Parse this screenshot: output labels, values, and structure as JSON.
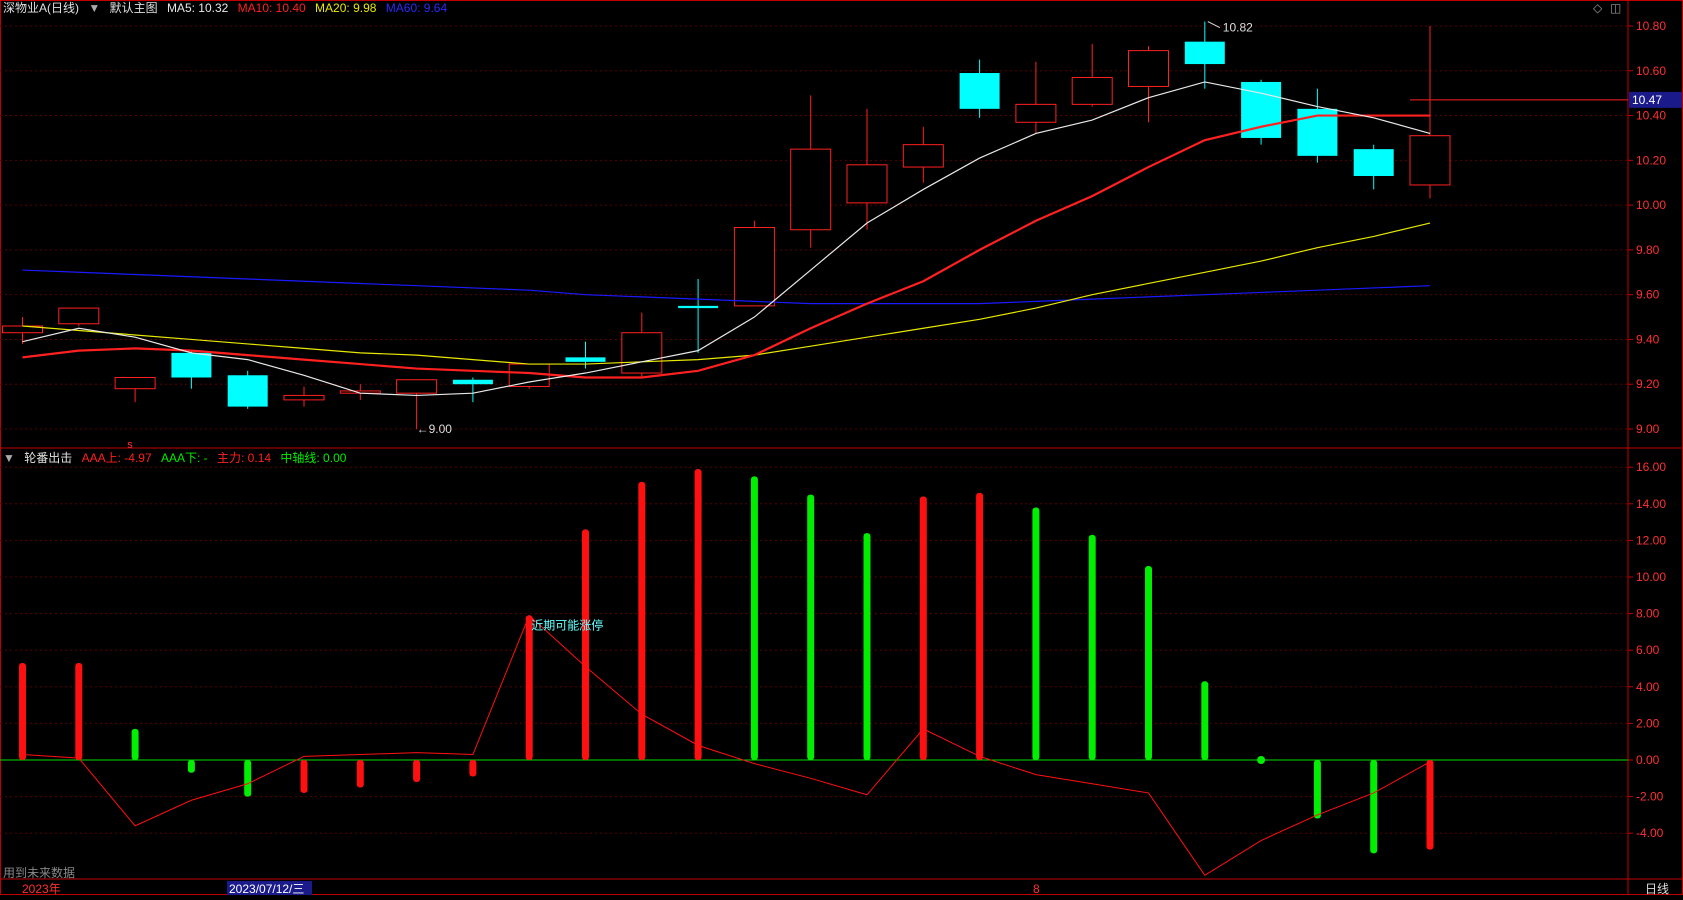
{
  "main_header": {
    "stock": "深物业A(日线)",
    "formula": "默认主图",
    "ma5": "MA5: 10.32",
    "ma10": "MA10: 10.40",
    "ma20": "MA20: 9.98",
    "ma60": "MA60: 9.64"
  },
  "sub_header": {
    "name": "轮番出击",
    "aaa_up": "AAA上: -4.97",
    "aaa_down": "AAA下: -",
    "main_force": "主力: 0.14",
    "center": "中轴线: 0.00"
  },
  "price_marker": "10.47",
  "high_label": "10.82",
  "low_label": "9.00",
  "annotation": "近期可能涨停",
  "future_note": "用到未来数据",
  "timeline": {
    "year": "2023年",
    "date": "2023/07/12/三",
    "month": "8",
    "period": "日线"
  },
  "small_marker": "s",
  "colors": {
    "up": "#ff2020",
    "down": "#00ffff",
    "ma5": "#e8e8e8",
    "ma10": "#ff2020",
    "ma20": "#e8e800",
    "ma60": "#1a1aff",
    "green": "#00ee00",
    "red": "#ff1010",
    "axis": "#c00000"
  },
  "chart_data": [
    {
      "type": "candlestick",
      "title": "深物业A(日线)",
      "ylim": [
        8.9,
        10.9
      ],
      "y_ticks": [
        "10.80",
        "10.60",
        "10.40",
        "10.20",
        "10.00",
        "9.80",
        "9.60",
        "9.40",
        "9.20",
        "9.00"
      ],
      "candles": [
        {
          "o": 9.43,
          "h": 9.5,
          "l": 9.38,
          "c": 9.46
        },
        {
          "o": 9.47,
          "h": 9.54,
          "l": 9.46,
          "c": 9.54
        },
        {
          "o": 9.18,
          "h": 9.22,
          "l": 9.12,
          "c": 9.23
        },
        {
          "o": 9.34,
          "h": 9.35,
          "l": 9.18,
          "c": 9.23
        },
        {
          "o": 9.24,
          "h": 9.26,
          "l": 9.09,
          "c": 9.1
        },
        {
          "o": 9.13,
          "h": 9.19,
          "l": 9.1,
          "c": 9.15
        },
        {
          "o": 9.16,
          "h": 9.2,
          "l": 9.13,
          "c": 9.17
        },
        {
          "o": 9.16,
          "h": 9.21,
          "l": 9.0,
          "c": 9.22
        },
        {
          "o": 9.22,
          "h": 9.23,
          "l": 9.12,
          "c": 9.2
        },
        {
          "o": 9.19,
          "h": 9.29,
          "l": 9.18,
          "c": 9.29
        },
        {
          "o": 9.32,
          "h": 9.39,
          "l": 9.27,
          "c": 9.3
        },
        {
          "o": 9.25,
          "h": 9.52,
          "l": 9.23,
          "c": 9.43
        },
        {
          "o": 9.55,
          "h": 9.67,
          "l": 9.34,
          "c": 9.54
        },
        {
          "o": 9.55,
          "h": 9.93,
          "l": 9.55,
          "c": 9.9
        },
        {
          "o": 9.89,
          "h": 10.49,
          "l": 9.81,
          "c": 10.25
        },
        {
          "o": 10.01,
          "h": 10.43,
          "l": 9.89,
          "c": 10.18
        },
        {
          "o": 10.17,
          "h": 10.35,
          "l": 10.1,
          "c": 10.27
        },
        {
          "o": 10.59,
          "h": 10.65,
          "l": 10.39,
          "c": 10.43
        },
        {
          "o": 10.37,
          "h": 10.64,
          "l": 10.32,
          "c": 10.45
        },
        {
          "o": 10.45,
          "h": 10.72,
          "l": 10.44,
          "c": 10.57
        },
        {
          "o": 10.53,
          "h": 10.71,
          "l": 10.37,
          "c": 10.69
        },
        {
          "o": 10.73,
          "h": 10.82,
          "l": 10.52,
          "c": 10.63
        },
        {
          "o": 10.55,
          "h": 10.56,
          "l": 10.27,
          "c": 10.3
        },
        {
          "o": 10.43,
          "h": 10.52,
          "l": 10.19,
          "c": 10.22
        },
        {
          "o": 10.25,
          "h": 10.27,
          "l": 10.07,
          "c": 10.13
        },
        {
          "o": 10.09,
          "h": 10.8,
          "l": 10.03,
          "c": 10.31
        }
      ],
      "ma5": [
        9.39,
        9.45,
        9.41,
        9.34,
        9.31,
        9.24,
        9.16,
        9.15,
        9.16,
        9.21,
        9.25,
        9.3,
        9.35,
        9.5,
        9.71,
        9.92,
        10.07,
        10.21,
        10.32,
        10.38,
        10.48,
        10.55,
        10.5,
        10.44,
        10.39,
        10.32
      ],
      "ma10": [
        9.32,
        9.35,
        9.36,
        9.35,
        9.33,
        9.31,
        9.29,
        9.27,
        9.26,
        9.25,
        9.23,
        9.23,
        9.26,
        9.33,
        9.45,
        9.56,
        9.66,
        9.8,
        9.93,
        10.04,
        10.17,
        10.29,
        10.35,
        10.4,
        10.4,
        10.4
      ],
      "ma20": [
        9.46,
        9.44,
        9.42,
        9.4,
        9.38,
        9.36,
        9.34,
        9.33,
        9.31,
        9.29,
        9.29,
        9.3,
        9.31,
        9.33,
        9.37,
        9.41,
        9.45,
        9.49,
        9.54,
        9.6,
        9.65,
        9.7,
        9.75,
        9.81,
        9.86,
        9.92,
        9.98
      ],
      "ma60": [
        9.71,
        9.7,
        9.69,
        9.68,
        9.67,
        9.66,
        9.65,
        9.64,
        9.63,
        9.62,
        9.6,
        9.59,
        9.58,
        9.57,
        9.56,
        9.56,
        9.56,
        9.56,
        9.57,
        9.58,
        9.59,
        9.6,
        9.61,
        9.62,
        9.63,
        9.64
      ]
    },
    {
      "type": "bar",
      "title": "轮番出击",
      "ylim": [
        -5.8,
        16.6
      ],
      "y_ticks": [
        "16.00",
        "14.00",
        "12.00",
        "10.00",
        "8.00",
        "6.00",
        "4.00",
        "2.00",
        "0.00",
        "-2.00",
        "-4.00"
      ],
      "bars": [
        {
          "v": 5.3,
          "color": "red"
        },
        {
          "v": 5.3,
          "color": "red"
        },
        {
          "v": 1.7,
          "color": "green"
        },
        {
          "v": -0.7,
          "color": "green"
        },
        {
          "v": -2.0,
          "color": "green"
        },
        {
          "v": -1.8,
          "color": "red"
        },
        {
          "v": -1.5,
          "color": "red"
        },
        {
          "v": -1.2,
          "color": "red"
        },
        {
          "v": -0.9,
          "color": "red"
        },
        {
          "v": 7.9,
          "color": "red"
        },
        {
          "v": 12.6,
          "color": "red"
        },
        {
          "v": 15.2,
          "color": "red"
        },
        {
          "v": 15.9,
          "color": "red"
        },
        {
          "v": 15.5,
          "color": "green"
        },
        {
          "v": 14.5,
          "color": "green"
        },
        {
          "v": 12.4,
          "color": "green"
        },
        {
          "v": 14.4,
          "color": "red"
        },
        {
          "v": 14.6,
          "color": "red"
        },
        {
          "v": 13.8,
          "color": "green"
        },
        {
          "v": 12.3,
          "color": "green"
        },
        {
          "v": 10.6,
          "color": "green"
        },
        {
          "v": 4.3,
          "color": "green"
        },
        {
          "v": 0,
          "color": "green"
        },
        {
          "v": -3.2,
          "color": "green"
        },
        {
          "v": -5.1,
          "color": "green"
        },
        {
          "v": -4.9,
          "color": "red"
        }
      ],
      "line": [
        0.3,
        0.1,
        -3.6,
        -2.2,
        -1.3,
        0.2,
        0.3,
        0.4,
        0.3,
        7.9,
        5.1,
        2.5,
        0.8,
        -0.2,
        -1.0,
        -1.9,
        1.7,
        0.2,
        -0.8,
        -1.3,
        -1.8,
        -6.3,
        -4.4,
        -3.0,
        -1.8,
        -0.1
      ]
    }
  ]
}
